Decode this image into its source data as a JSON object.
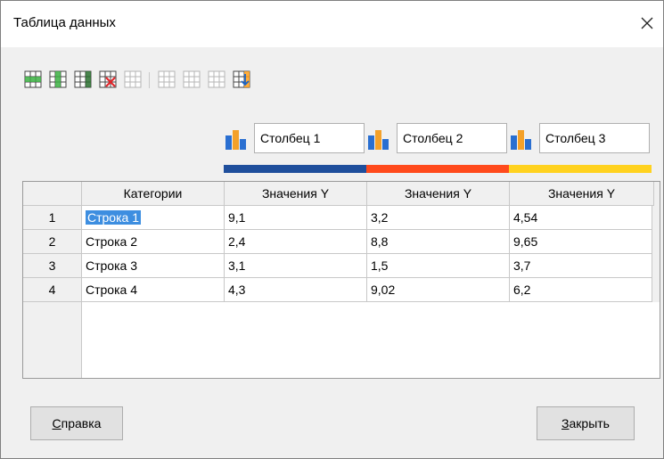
{
  "dialog": {
    "title": "Таблица данных"
  },
  "toolbar": {
    "icons": [
      "insert-row-icon",
      "insert-series-icon",
      "insert-text-column-icon",
      "delete-row-icon",
      "delete-series-icon",
      "move-up-icon",
      "move-down-icon",
      "move-left-icon",
      "move-right-icon"
    ]
  },
  "series": [
    {
      "name": "Столбец 1",
      "color": "#1f4f9c"
    },
    {
      "name": "Столбец 2",
      "color": "#ff4a1c"
    },
    {
      "name": "Столбец 3",
      "color": "#ffd21f"
    }
  ],
  "table": {
    "headers": [
      "Категории",
      "Значения Y",
      "Значения Y",
      "Значения Y"
    ],
    "rows": [
      {
        "num": "1",
        "cells": [
          "Строка 1",
          "9,1",
          "3,2",
          "4,54"
        ]
      },
      {
        "num": "2",
        "cells": [
          "Строка 2",
          "2,4",
          "8,8",
          "9,65"
        ]
      },
      {
        "num": "3",
        "cells": [
          "Строка 3",
          "3,1",
          "1,5",
          "3,7"
        ]
      },
      {
        "num": "4",
        "cells": [
          "Строка 4",
          "4,3",
          "9,02",
          "6,2"
        ]
      }
    ]
  },
  "buttons": {
    "help_mnemonic": "С",
    "help_rest": "правка",
    "close_mnemonic": "З",
    "close_rest": "акрыть"
  }
}
